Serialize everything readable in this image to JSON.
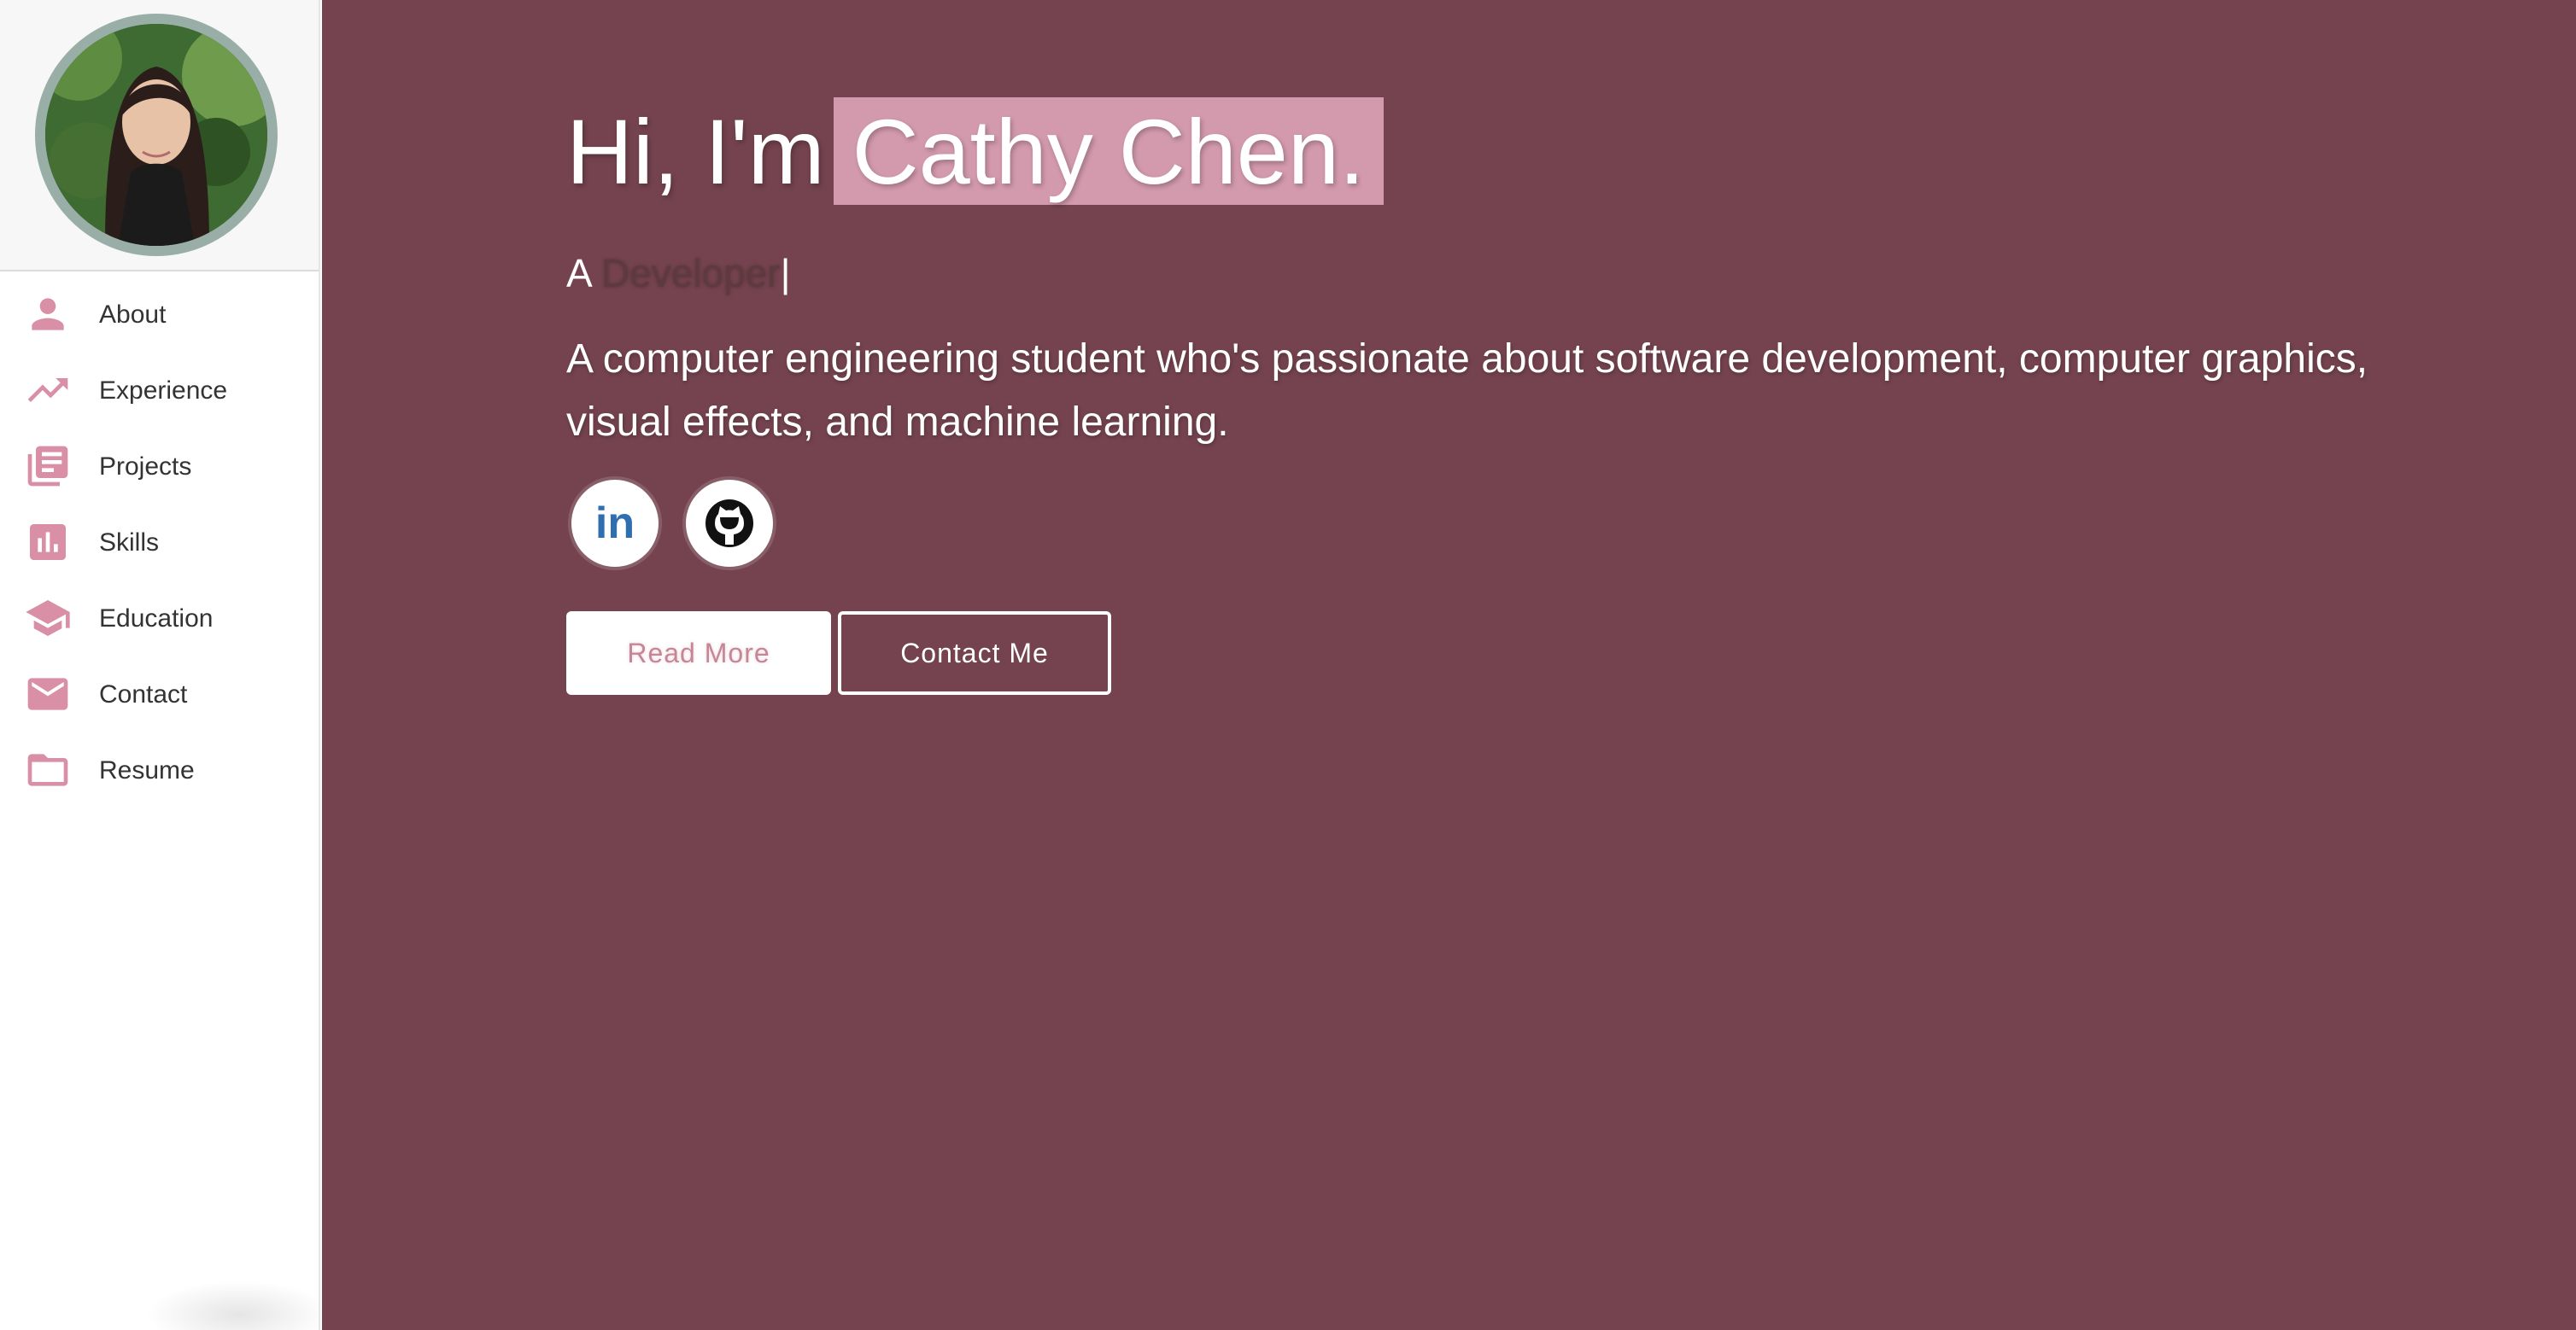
{
  "sidebar": {
    "avatar_alt": "profile photo",
    "items": [
      {
        "label": "About",
        "icon": "person-icon"
      },
      {
        "label": "Experience",
        "icon": "trending-up-icon"
      },
      {
        "label": "Projects",
        "icon": "library-books-icon"
      },
      {
        "label": "Skills",
        "icon": "bar-chart-icon"
      },
      {
        "label": "Education",
        "icon": "graduation-cap-icon"
      },
      {
        "label": "Contact",
        "icon": "mail-icon"
      },
      {
        "label": "Resume",
        "icon": "folder-icon"
      }
    ]
  },
  "hero": {
    "greeting": "Hi, I'm",
    "name": "Cathy Chen.",
    "role_prefix": "A",
    "role": "Developer",
    "cursor": "|",
    "description": "A computer engineering student who's passionate about software development, computer graphics, visual effects, and machine learning.",
    "social": [
      {
        "name": "LinkedIn",
        "icon": "linkedin-icon",
        "text": "in"
      },
      {
        "name": "GitHub",
        "icon": "github-icon"
      }
    ],
    "read_more_label": "Read More",
    "contact_label": "Contact Me"
  },
  "colors": {
    "main_bg": "#74434f",
    "accent_pink": "#d39aad",
    "icon_pink": "#d98fa6",
    "avatar_ring": "#9aaea8",
    "linkedin_blue": "#2f6fb0"
  }
}
